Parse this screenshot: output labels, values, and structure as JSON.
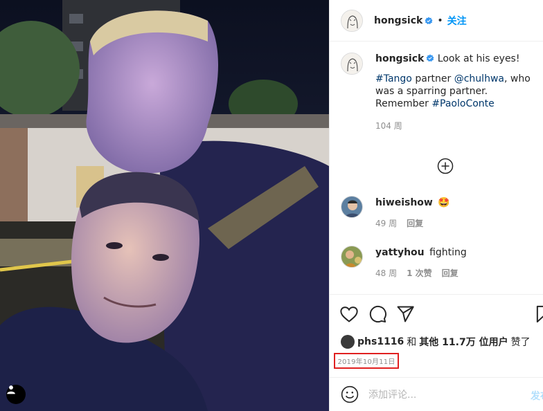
{
  "post": {
    "author": "hongsick",
    "follow_label": "关注",
    "separator": "•"
  },
  "caption": {
    "username": "hongsick",
    "text_1": "Look at his eyes!",
    "hashtag_1": "#Tango",
    "text_2": " partner ",
    "mention": "@chulhwa",
    "text_3": ", who was a sparring partner. Remember ",
    "hashtag_2": "#PaoloConte",
    "age": "104 周"
  },
  "comments": [
    {
      "username": "hiweishow",
      "text": "🤩",
      "age": "49 周",
      "likes": "",
      "reply_label": "回复"
    },
    {
      "username": "yattyhou",
      "text": "fighting",
      "age": "48 周",
      "likes": "1 次赞",
      "reply_label": "回复"
    }
  ],
  "likes": {
    "user": "phs1116",
    "and": "和",
    "others": "其他 11.7万 位用户",
    "suffix": "赞了"
  },
  "date": "2019年10月11日",
  "composer": {
    "placeholder": "添加评论...",
    "post_label": "发布"
  },
  "colors": {
    "link_blue": "#0095f6",
    "hashtag": "#00376b",
    "verified": "#3897f0",
    "date_highlight": "#e02020"
  },
  "icons": [
    "user-tag-icon",
    "verified-badge-icon",
    "add-circle-icon",
    "heart-icon",
    "comment-icon",
    "share-icon",
    "bookmark-icon",
    "emoji-icon"
  ]
}
